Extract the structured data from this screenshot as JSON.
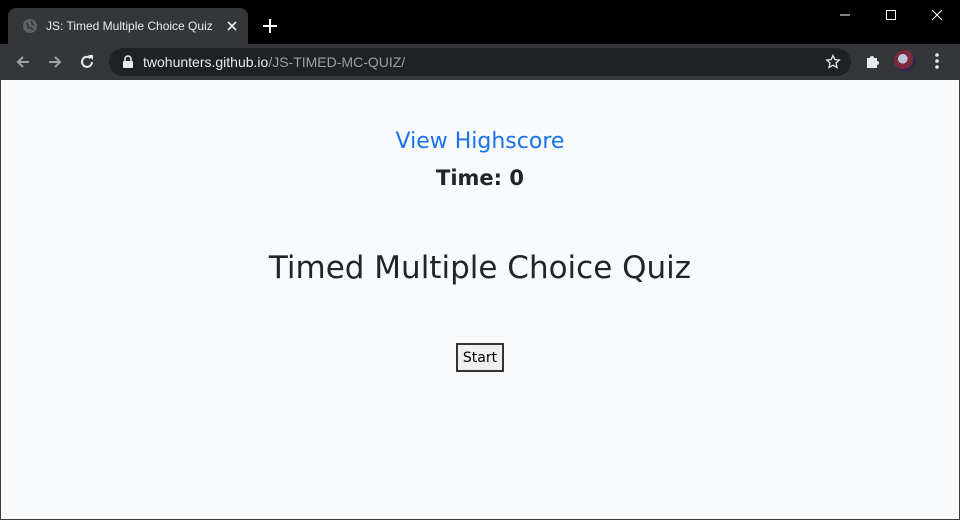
{
  "browser": {
    "tab": {
      "title": "JS: Timed Multiple Choice Quiz"
    },
    "address": {
      "host": "twohunters.github.io",
      "path": "/JS-TIMED-MC-QUIZ/"
    }
  },
  "page": {
    "highscore_link": "View Highscore",
    "timer_label": "Time: 0",
    "title": "Timed Multiple Choice Quiz",
    "start_label": "Start"
  },
  "icons": {
    "tab_favicon": "globe-icon",
    "tab_close": "close-icon",
    "new_tab": "plus-icon",
    "back": "arrow-left-icon",
    "forward": "arrow-right-icon",
    "reload": "reload-icon",
    "lock": "lock-icon",
    "bookmark": "star-icon",
    "extensions": "puzzle-icon",
    "menu": "kebab-menu-icon"
  },
  "colors": {
    "link": "#1a73e8",
    "page_background": "#f8f9fa",
    "text": "#212529"
  }
}
